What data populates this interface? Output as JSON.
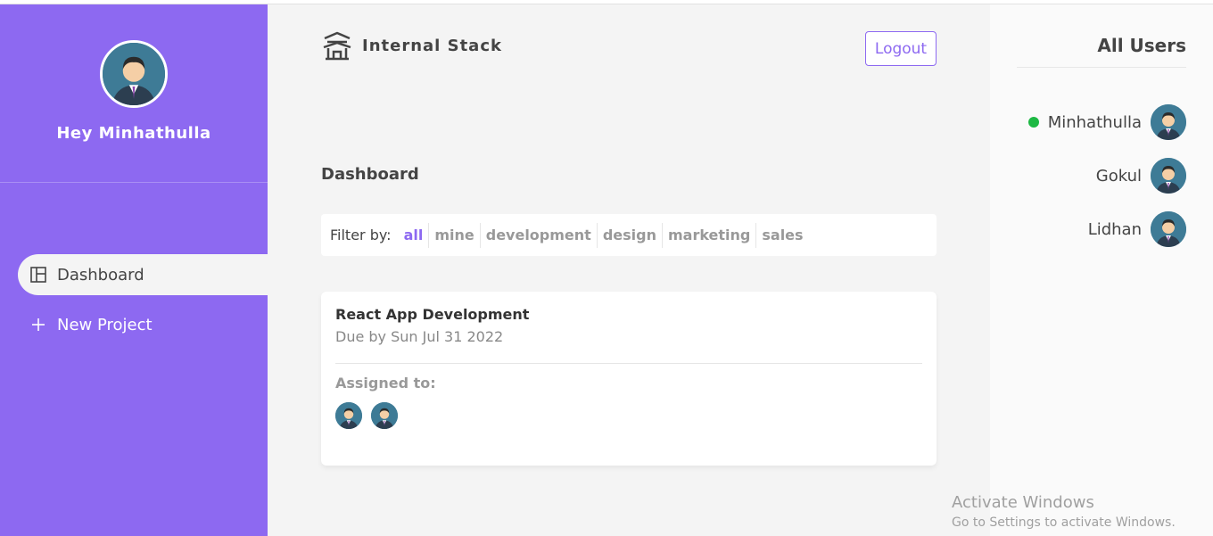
{
  "sidebar": {
    "greeting": "Hey Minhathulla",
    "nav": [
      {
        "label": "Dashboard",
        "icon": "dashboard-icon",
        "active": true
      },
      {
        "label": "New Project",
        "icon": "plus-icon",
        "active": false
      }
    ]
  },
  "header": {
    "brand": "Internal Stack",
    "brand_icon": "temple-icon",
    "logout_label": "Logout"
  },
  "main": {
    "title": "Dashboard",
    "filter": {
      "label": "Filter by:",
      "options": [
        "all",
        "mine",
        "development",
        "design",
        "marketing",
        "sales"
      ],
      "selected": "all"
    },
    "projects": [
      {
        "title": "React App Development",
        "due": "Due by Sun Jul 31 2022",
        "assigned_label": "Assigned to:",
        "assignee_count": 2
      }
    ]
  },
  "users_panel": {
    "title": "All Users",
    "users": [
      {
        "name": "Minhathulla",
        "online": true
      },
      {
        "name": "Gokul",
        "online": false
      },
      {
        "name": "Lidhan",
        "online": false
      }
    ]
  },
  "watermark": {
    "title": "Activate Windows",
    "subtitle": "Go to Settings to activate Windows."
  },
  "colors": {
    "accent": "#8d69f1",
    "online": "#1db843",
    "background": "#f4f4f4"
  }
}
